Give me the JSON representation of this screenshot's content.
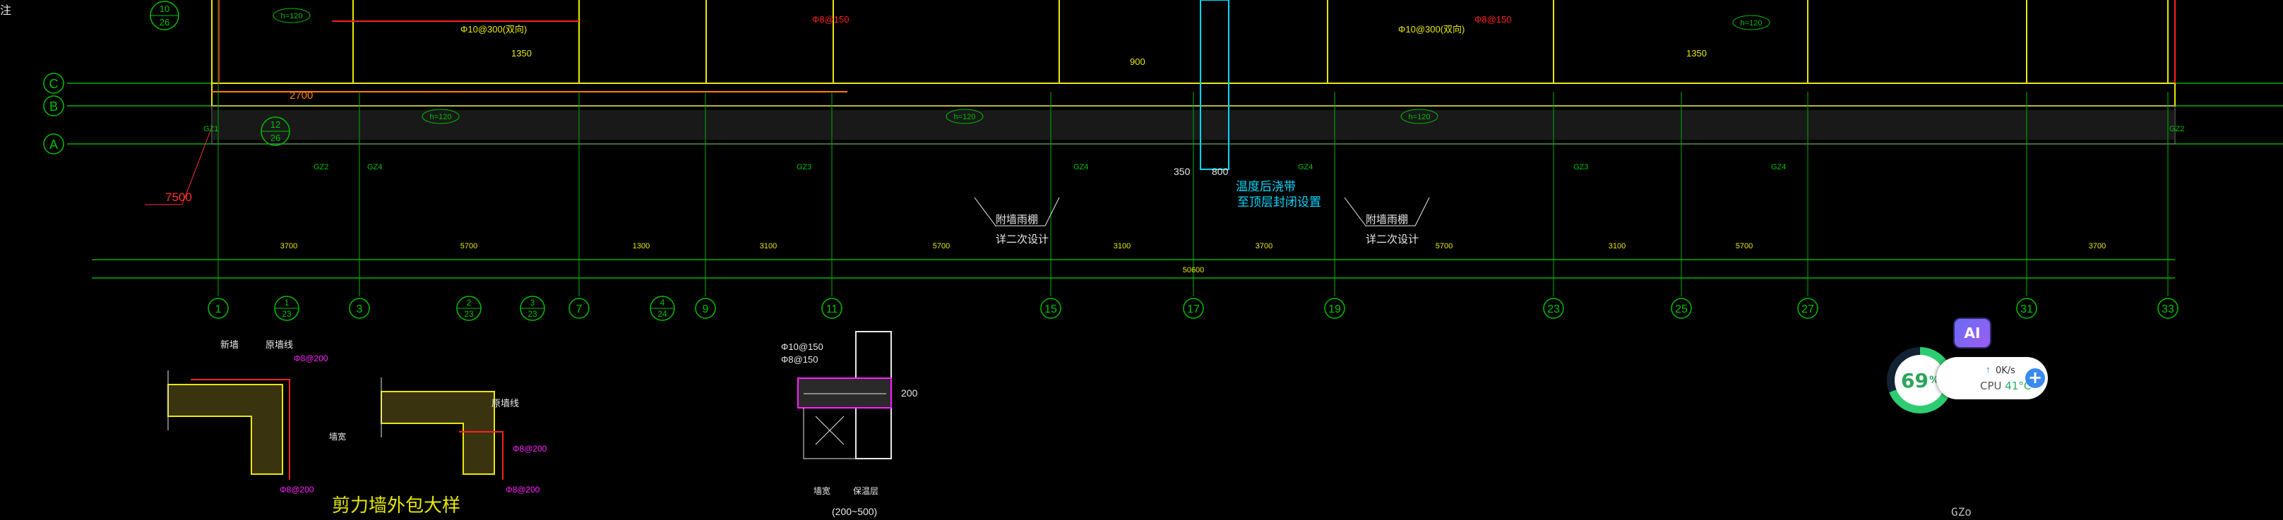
{
  "axes_horizontal": [
    {
      "label": "C"
    },
    {
      "label": "B"
    },
    {
      "label": "A"
    }
  ],
  "axes_vertical": [
    "1",
    "3",
    "7",
    "9",
    "11",
    "15",
    "17",
    "19",
    "23",
    "25",
    "27",
    "31",
    "33"
  ],
  "aux_axes": [
    {
      "num": "1",
      "den": "23"
    },
    {
      "num": "2",
      "den": "23"
    },
    {
      "num": "3",
      "den": "23"
    },
    {
      "num": "4",
      "den": "24"
    }
  ],
  "top_tags": [
    {
      "num": "10",
      "den": "26"
    },
    {
      "num": "12",
      "den": "26"
    }
  ],
  "dims_small": [
    "3700",
    "5700",
    "1300",
    "3100",
    "5700",
    "3100",
    "3700",
    "5700",
    "3100",
    "5700",
    "3700"
  ],
  "dim_total": "50600",
  "dim_7500": "7500",
  "dim_2700": "2700",
  "dim_350": "350",
  "dim_800": "800",
  "dim_1350": "1350",
  "dim_900": "900",
  "dim_200": "200",
  "dim_range": "(200~500)",
  "expansion_note_1": "温度后浇带",
  "expansion_note_2": "至顶层封闭设置",
  "canopy_note_1": "附墙雨棚",
  "canopy_note_2": "详二次设计",
  "rebar_spec": "Φ10@300(双向)",
  "rebar_spec2": "Φ8@150",
  "rebar_a": "Φ10@150",
  "rebar_b": "Φ8@150",
  "rebar_c": "Φ8@200",
  "h_tag": "h=120",
  "gz_labels": [
    "GZ1",
    "GZ2",
    "GZ3",
    "GZ4"
  ],
  "detail_title": "剪力墙外包大样",
  "detail_label_1": "新墙",
  "detail_label_2": "原墙线",
  "detail_label_3": "墙宽",
  "detail_label_4": "保温层",
  "corner_text": "注",
  "side_text": "200",
  "widget": {
    "ai_label": "AI",
    "percent": "69",
    "percent_unit": "%",
    "net_speed": "0K/s",
    "cpu_label": "CPU",
    "cpu_temp": "41°C",
    "plus": "+"
  },
  "command_line": "GZo",
  "colors": {
    "grid": "#00c000",
    "wall": "#e8e800",
    "red": "#ff2020",
    "cyan": "#00d8ff",
    "magenta": "#ff20ff",
    "white": "#e8e8e8",
    "orange": "#ff8000"
  }
}
